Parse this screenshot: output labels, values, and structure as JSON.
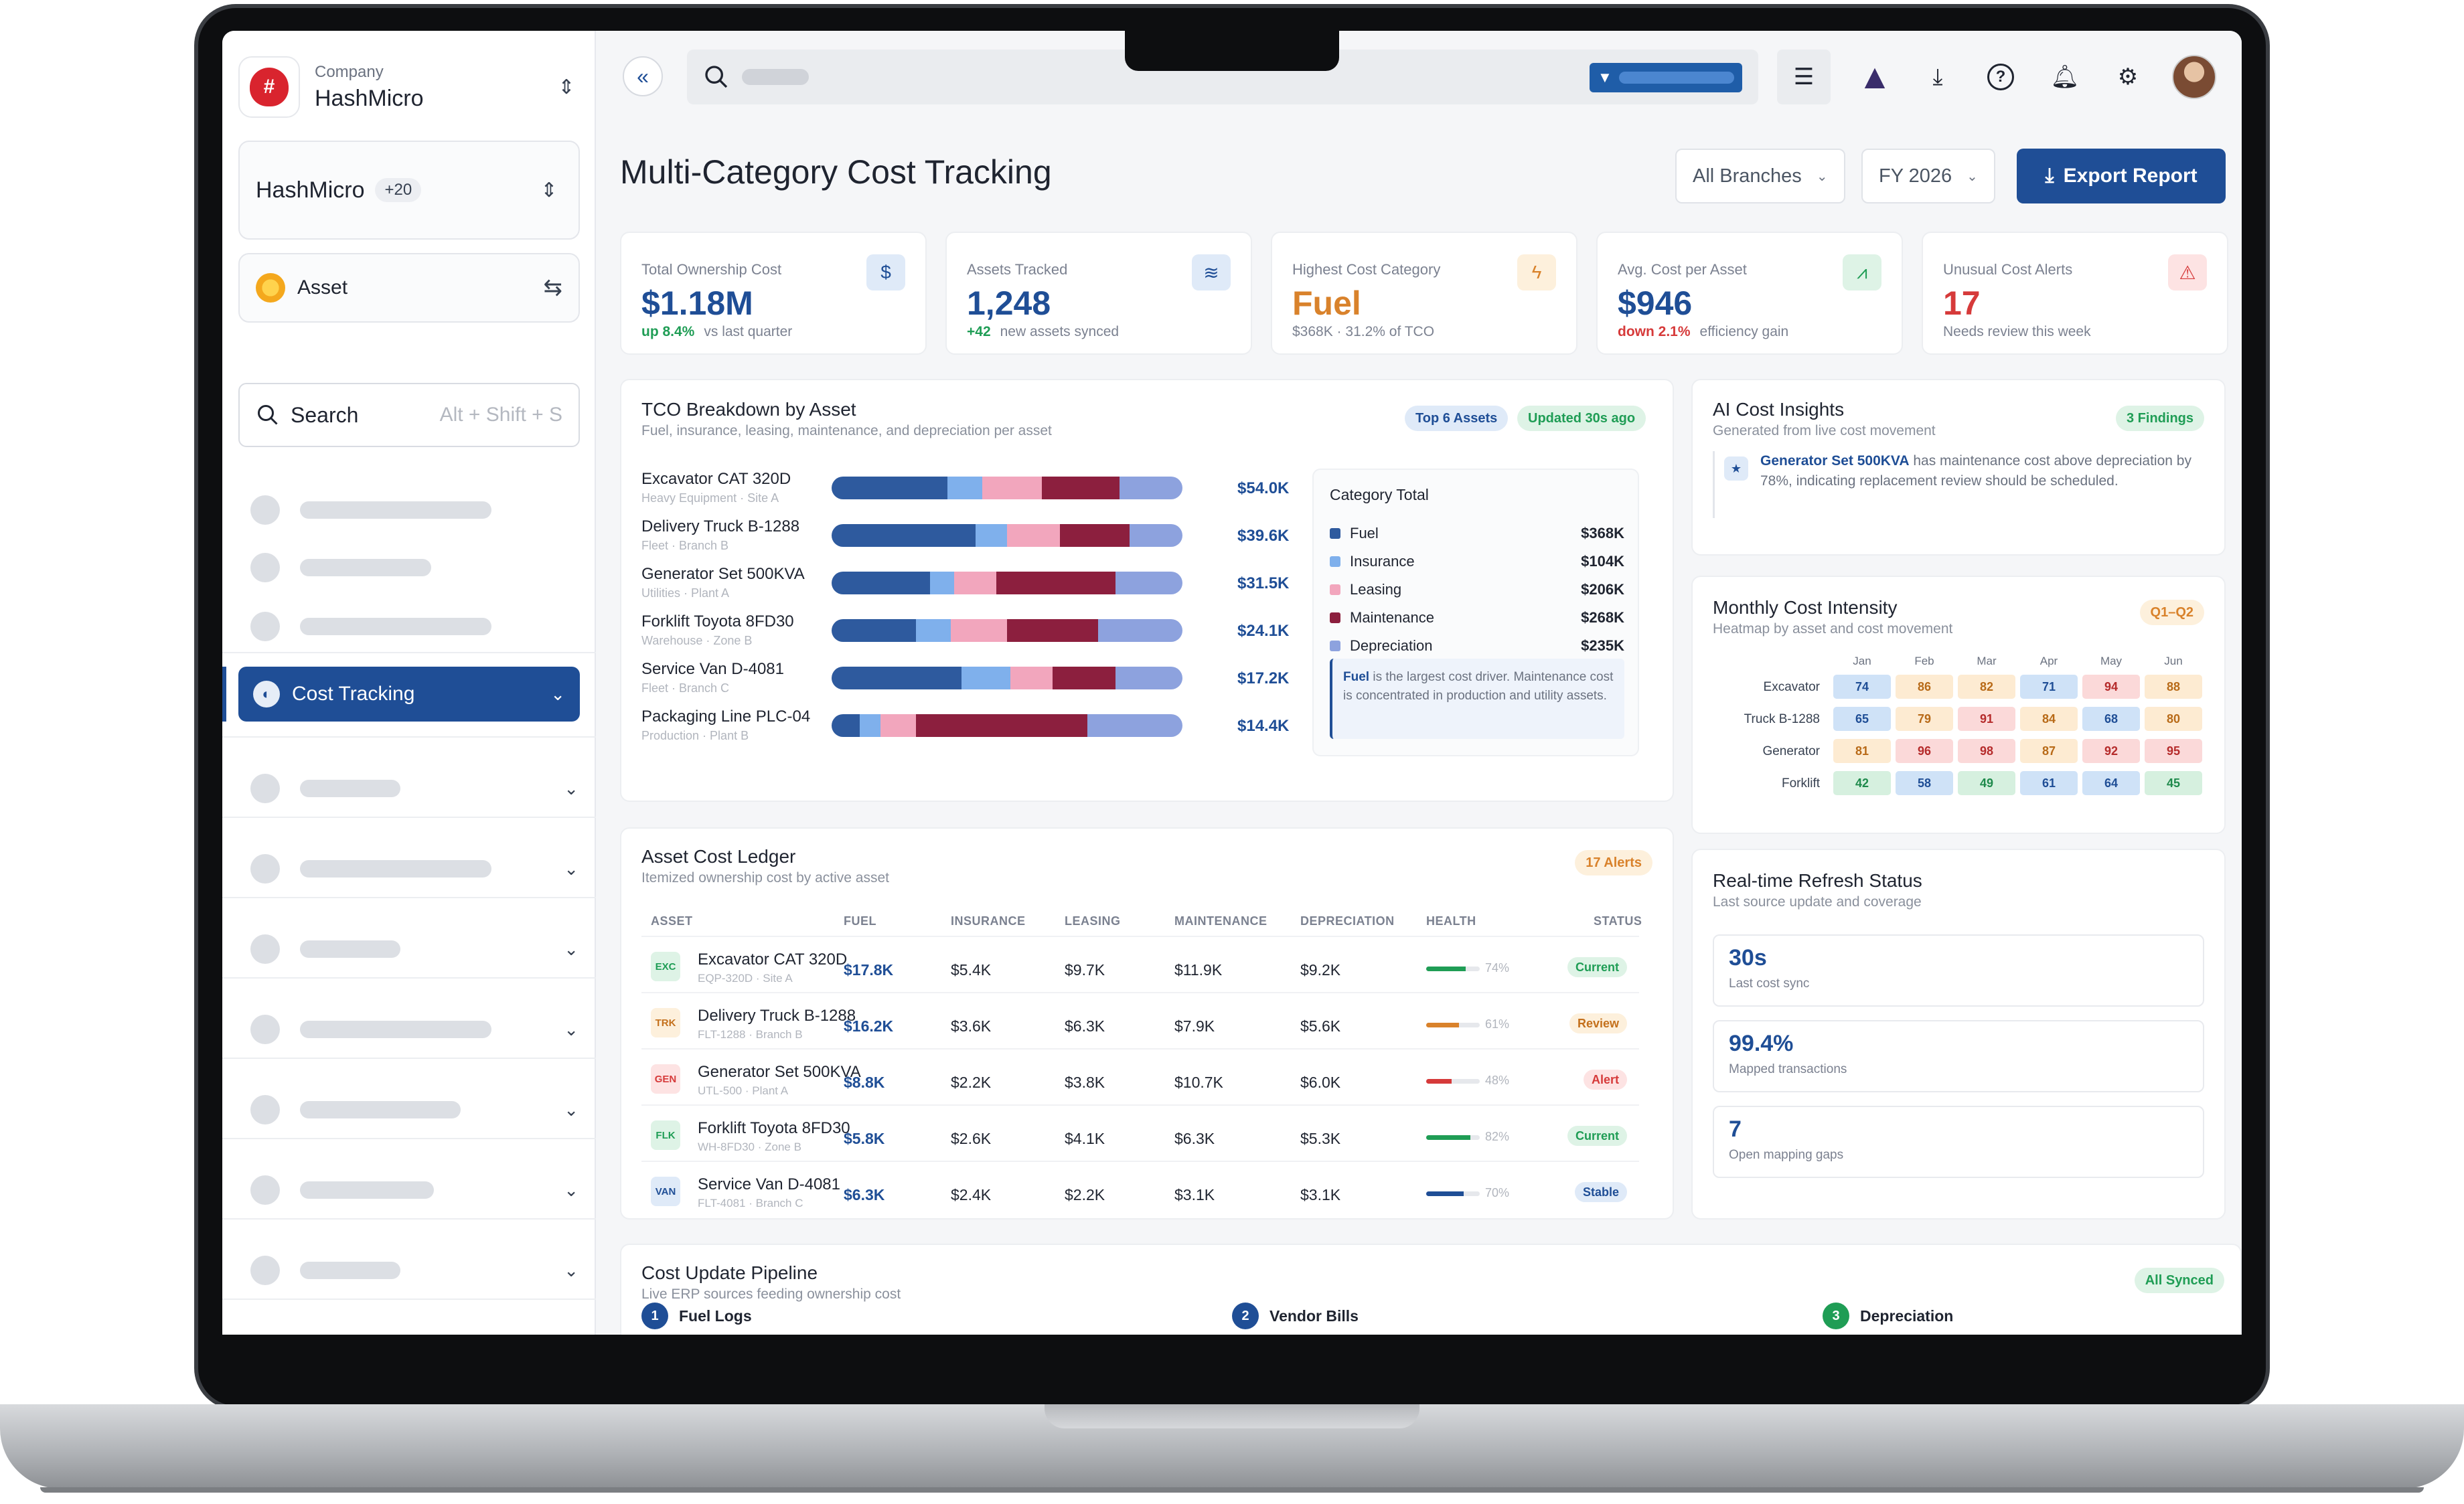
{
  "company": {
    "label": "Company",
    "name": "HashMicro"
  },
  "org_selector": {
    "name": "HashMicro",
    "count": "+20"
  },
  "module_selector": {
    "name": "Asset"
  },
  "sidebar_search": {
    "label": "Search",
    "shortcut": "Alt + Shift + S"
  },
  "nav_active": {
    "label": "Cost Tracking"
  },
  "page": {
    "title": "Multi-Category Cost Tracking"
  },
  "filters": {
    "branch": "All Branches",
    "year": "FY 2026",
    "export_label": "Export Report"
  },
  "kpis": [
    {
      "label": "Total Ownership Cost",
      "value": "$1.18M",
      "delta": "up 8.4%",
      "note": "vs last quarter",
      "icon": "dollar-icon"
    },
    {
      "label": "Assets Tracked",
      "value": "1,248",
      "delta": "+42",
      "note": "new assets synced",
      "icon": "layers-icon"
    },
    {
      "label": "Highest Cost Category",
      "value": "Fuel",
      "delta": "",
      "note": "$368K · 31.2% of TCO",
      "icon": "bolt-icon"
    },
    {
      "label": "Avg. Cost per Asset",
      "value": "$946",
      "delta": "down 2.1%",
      "note": "efficiency gain",
      "icon": "chart-icon"
    },
    {
      "label": "Unusual Cost Alerts",
      "value": "17",
      "delta": "",
      "note": "Needs review this week",
      "icon": "warning-icon"
    }
  ],
  "tco": {
    "title": "TCO Breakdown by Asset",
    "subtitle": "Fuel, insurance, leasing, maintenance, and depreciation per asset",
    "badge_top": "Top 6 Assets",
    "badge_updated": "Updated 30s ago",
    "colors": {
      "fuel": "#2e5a9e",
      "insurance": "#7fb0ec",
      "leasing": "#f2a6bd",
      "maintenance": "#8c1f3e",
      "depreciation": "#8da2de"
    },
    "assets": [
      {
        "name": "Excavator CAT 320D",
        "sub": "Heavy Equipment · Site A",
        "total": "$54.0K",
        "parts": [
          33,
          10,
          17,
          22,
          18
        ]
      },
      {
        "name": "Delivery Truck B-1288",
        "sub": "Fleet · Branch B",
        "total": "$39.6K",
        "parts": [
          41,
          9,
          15,
          20,
          15
        ]
      },
      {
        "name": "Generator Set 500KVA",
        "sub": "Utilities · Plant A",
        "total": "$31.5K",
        "parts": [
          28,
          7,
          12,
          34,
          19
        ]
      },
      {
        "name": "Forklift Toyota 8FD30",
        "sub": "Warehouse · Zone B",
        "total": "$24.1K",
        "parts": [
          24,
          10,
          16,
          26,
          24
        ]
      },
      {
        "name": "Service Van D-4081",
        "sub": "Fleet · Branch C",
        "total": "$17.2K",
        "parts": [
          37,
          14,
          12,
          18,
          19
        ]
      },
      {
        "name": "Packaging Line PLC-04",
        "sub": "Production · Plant B",
        "total": "$14.4K",
        "parts": [
          8,
          6,
          10,
          49,
          27
        ]
      }
    ],
    "legend_title": "Category Total",
    "legend": [
      {
        "name": "Fuel",
        "value": "$368K"
      },
      {
        "name": "Insurance",
        "value": "$104K"
      },
      {
        "name": "Leasing",
        "value": "$206K"
      },
      {
        "name": "Maintenance",
        "value": "$268K"
      },
      {
        "name": "Depreciation",
        "value": "$235K"
      }
    ],
    "note_strong": "Fuel",
    "note_text": " is the largest cost driver. Maintenance cost is concentrated in production and utility assets."
  },
  "insights": {
    "title": "AI Cost Insights",
    "subtitle": "Generated from live cost movement",
    "badge": "3 Findings",
    "item_strong": "Generator Set 500KVA",
    "item_text": " has maintenance cost above depreciation by 78%, indicating replacement review should be scheduled."
  },
  "heatmap": {
    "title": "Monthly Cost Intensity",
    "subtitle": "Heatmap by asset and cost movement",
    "badge": "Q1–Q2",
    "months": [
      "Jan",
      "Feb",
      "Mar",
      "Apr",
      "May",
      "Jun"
    ],
    "rows": [
      {
        "label": "Excavator",
        "values": [
          "74",
          "86",
          "82",
          "71",
          "94",
          "88"
        ],
        "tones": [
          "b",
          "o",
          "o",
          "b",
          "r",
          "o"
        ]
      },
      {
        "label": "Truck B-1288",
        "values": [
          "65",
          "79",
          "91",
          "84",
          "68",
          "80"
        ],
        "tones": [
          "b",
          "o",
          "r",
          "o",
          "b",
          "o"
        ]
      },
      {
        "label": "Generator",
        "values": [
          "81",
          "96",
          "98",
          "87",
          "92",
          "95"
        ],
        "tones": [
          "o",
          "r",
          "r",
          "o",
          "r",
          "r"
        ]
      },
      {
        "label": "Forklift",
        "values": [
          "42",
          "58",
          "49",
          "61",
          "64",
          "45"
        ],
        "tones": [
          "g",
          "b",
          "g",
          "b",
          "b",
          "g"
        ]
      }
    ]
  },
  "ledger": {
    "title": "Asset Cost Ledger",
    "subtitle": "Itemized ownership cost by active asset",
    "badge": "17 Alerts",
    "headers": [
      "ASSET",
      "FUEL",
      "INSURANCE",
      "LEASING",
      "MAINTENANCE",
      "DEPRECIATION",
      "HEALTH",
      "STATUS"
    ],
    "rows": [
      {
        "tag": "EXC",
        "name": "Excavator CAT 320D",
        "code": "EQP-320D · Site A",
        "fuel": "$17.8K",
        "insurance": "$5.4K",
        "leasing": "$9.7K",
        "maintenance": "$11.9K",
        "depreciation": "$9.2K",
        "health": 74,
        "health_label": "74%",
        "status": "Current",
        "tone": "green"
      },
      {
        "tag": "TRK",
        "name": "Delivery Truck B-1288",
        "code": "FLT-1288 · Branch B",
        "fuel": "$16.2K",
        "insurance": "$3.6K",
        "leasing": "$6.3K",
        "maintenance": "$7.9K",
        "depreciation": "$5.6K",
        "health": 61,
        "health_label": "61%",
        "status": "Review",
        "tone": "orange"
      },
      {
        "tag": "GEN",
        "name": "Generator Set 500KVA",
        "code": "UTL-500 · Plant A",
        "fuel": "$8.8K",
        "insurance": "$2.2K",
        "leasing": "$3.8K",
        "maintenance": "$10.7K",
        "depreciation": "$6.0K",
        "health": 48,
        "health_label": "48%",
        "status": "Alert",
        "tone": "red"
      },
      {
        "tag": "FLK",
        "name": "Forklift Toyota 8FD30",
        "code": "WH-8FD30 · Zone B",
        "fuel": "$5.8K",
        "insurance": "$2.6K",
        "leasing": "$4.1K",
        "maintenance": "$6.3K",
        "depreciation": "$5.3K",
        "health": 82,
        "health_label": "82%",
        "status": "Current",
        "tone": "green"
      },
      {
        "tag": "VAN",
        "name": "Service Van D-4081",
        "code": "FLT-4081 · Branch C",
        "fuel": "$6.3K",
        "insurance": "$2.4K",
        "leasing": "$2.2K",
        "maintenance": "$3.1K",
        "depreciation": "$3.1K",
        "health": 70,
        "health_label": "70%",
        "status": "Stable",
        "tone": "blue"
      }
    ]
  },
  "refresh": {
    "title": "Real-time Refresh Status",
    "subtitle": "Last source update and coverage",
    "items": [
      {
        "value": "30s",
        "label": "Last cost sync"
      },
      {
        "value": "99.4%",
        "label": "Mapped transactions"
      },
      {
        "value": "7",
        "label": "Open mapping gaps"
      }
    ]
  },
  "pipeline": {
    "title": "Cost Update Pipeline",
    "subtitle": "Live ERP sources feeding ownership cost",
    "badge": "All Synced",
    "steps": [
      {
        "n": "1",
        "label": "Fuel Logs"
      },
      {
        "n": "2",
        "label": "Vendor Bills"
      },
      {
        "n": "3",
        "label": "Depreciation"
      }
    ]
  }
}
